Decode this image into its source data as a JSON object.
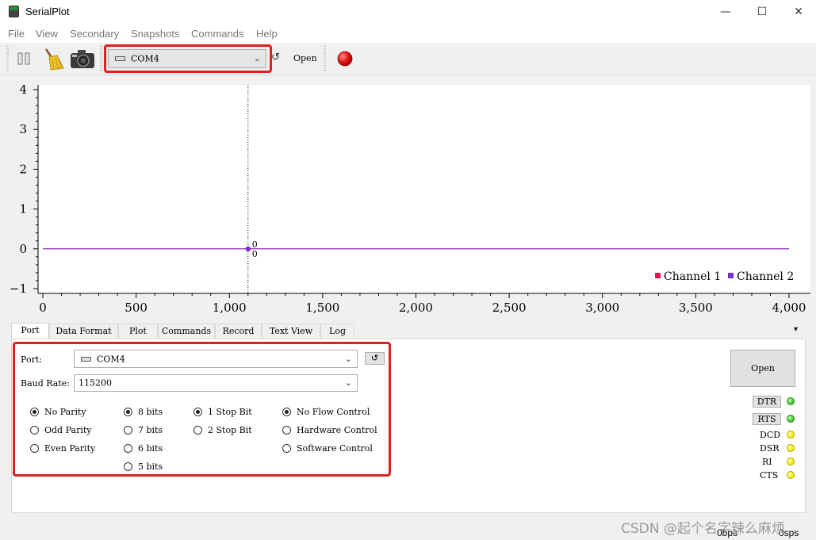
{
  "window": {
    "title": "SerialPlot",
    "minimize_glyph": "—",
    "maximize_glyph": "☐",
    "close_glyph": "✕"
  },
  "menu": {
    "items": [
      "File",
      "View",
      "Secondary",
      "Snapshots",
      "Commands",
      "Help"
    ]
  },
  "toolbar": {
    "icons": [
      "pause-icon",
      "broom-icon",
      "camera-icon",
      "refresh-icon",
      "record-icon"
    ],
    "port_value": "COM4",
    "refresh_glyph": "↺",
    "open_label": "Open"
  },
  "chart_data": {
    "type": "line",
    "xlim": [
      0,
      4000
    ],
    "ylim": [
      -1,
      4
    ],
    "x_ticks": [
      "0",
      "500",
      "1,000",
      "1,500",
      "2,000",
      "2,500",
      "3,000",
      "3,500",
      "4,000"
    ],
    "y_ticks": [
      "4",
      "3",
      "2",
      "1",
      "0",
      "−1"
    ],
    "series": [
      {
        "name": "Channel 1",
        "color": "#e8114e",
        "values": [
          0,
          0
        ]
      },
      {
        "name": "Channel 2",
        "color": "#7b2fcf",
        "values": [
          0,
          0
        ]
      }
    ],
    "x": [
      0,
      4000
    ],
    "cursor_x": 1100,
    "cursor_labels": [
      "0",
      "0"
    ],
    "legend_position": "bottom-right",
    "grid": false
  },
  "tabs": {
    "items": [
      "Port",
      "Data Format",
      "Plot",
      "Commands",
      "Record",
      "Text View",
      "Log"
    ],
    "active": "Port",
    "overflow_glyph": "▾"
  },
  "port_panel": {
    "port_label": "Port:",
    "port_value": "COM4",
    "refresh_glyph": "↺",
    "baud_label": "Baud Rate:",
    "baud_value": "115200",
    "parity": [
      "No Parity",
      "Odd Parity",
      "Even Parity"
    ],
    "data_bits": [
      "8 bits",
      "7 bits",
      "6 bits",
      "5 bits"
    ],
    "stop_bits": [
      "1 Stop Bit",
      "2 Stop Bit"
    ],
    "flow_control": [
      "No Flow Control",
      "Hardware Control",
      "Software Control"
    ],
    "selected": {
      "parity": "No Parity",
      "data_bits": "8 bits",
      "stop_bits": "1 Stop Bit",
      "flow_control": "No Flow Control"
    },
    "open_label": "Open",
    "dtr_label": "DTR",
    "rts_label": "RTS",
    "pins": [
      "DCD",
      "DSR",
      "RI",
      "CTS"
    ]
  },
  "status": {
    "bps": "0bps",
    "sps": "0sps"
  },
  "watermark": "CSDN @起个名字辣么麻烦"
}
